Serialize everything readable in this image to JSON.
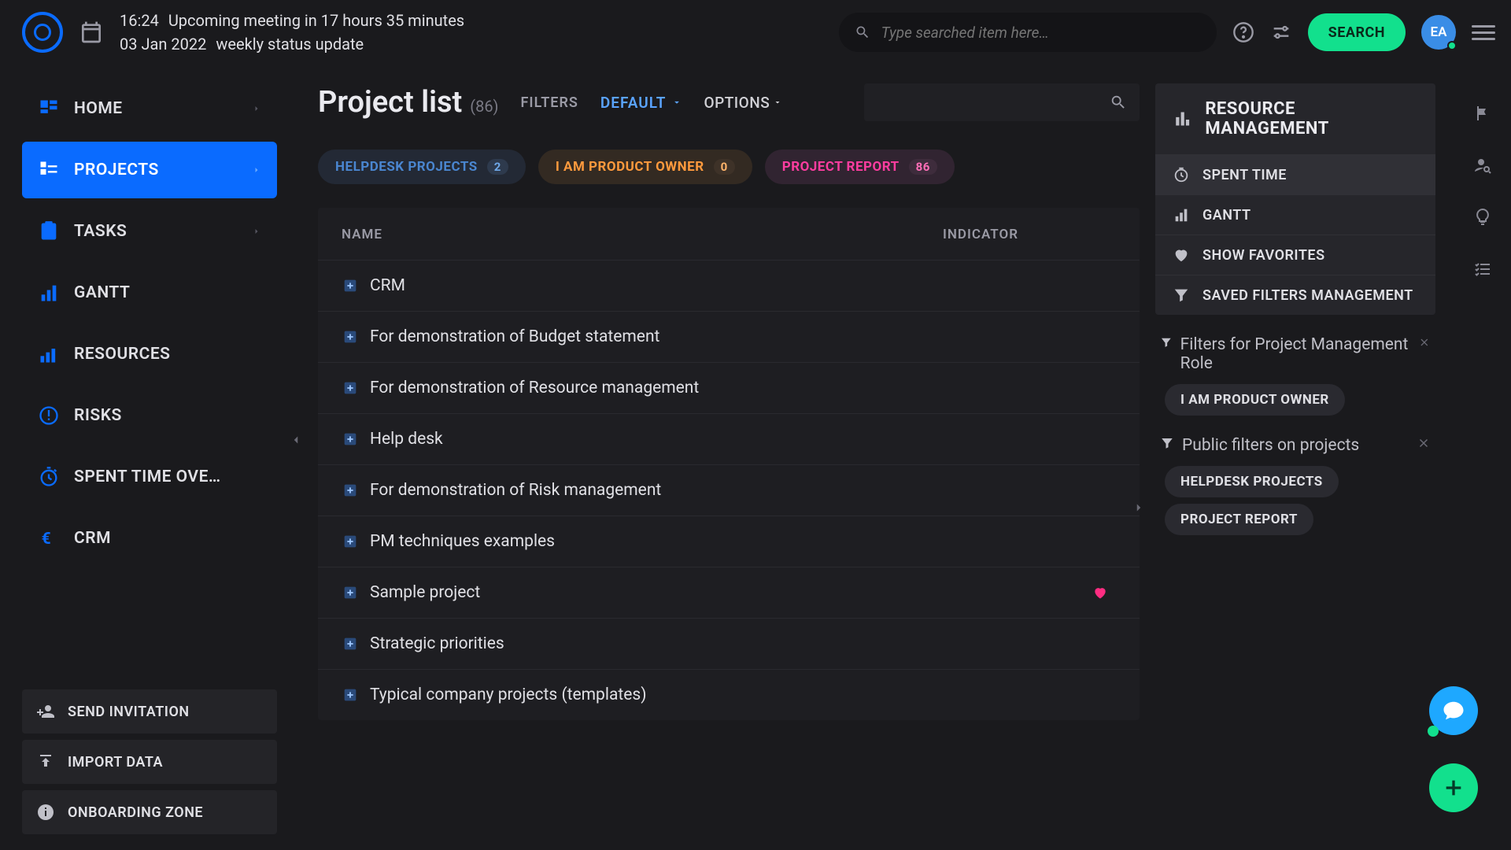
{
  "topbar": {
    "time": "16:24",
    "date": "03 Jan 2022",
    "upcoming": "Upcoming meeting in 17 hours 35 minutes",
    "event": "weekly status update",
    "search_placeholder": "Type searched item here…",
    "search_btn": "SEARCH",
    "avatar": "EA"
  },
  "sidebar": {
    "items": [
      {
        "label": "HOME",
        "icon": "home",
        "caret": true
      },
      {
        "label": "PROJECTS",
        "icon": "projects",
        "caret": true,
        "active": true
      },
      {
        "label": "TASKS",
        "icon": "tasks",
        "caret": true
      },
      {
        "label": "GANTT",
        "icon": "gantt"
      },
      {
        "label": "RESOURCES",
        "icon": "resources"
      },
      {
        "label": "RISKS",
        "icon": "risks"
      },
      {
        "label": "SPENT TIME OVE…",
        "icon": "spent"
      },
      {
        "label": "CRM",
        "icon": "crm"
      }
    ],
    "actions": {
      "invite": "SEND INVITATION",
      "import": "IMPORT DATA",
      "onboarding": "ONBOARDING ZONE"
    }
  },
  "page": {
    "title": "Project list",
    "count": "(86)",
    "filters_label": "FILTERS",
    "filters_value": "DEFAULT",
    "options_label": "OPTIONS"
  },
  "chips": [
    {
      "label": "HELPDESK PROJECTS",
      "count": "2",
      "color": "blue"
    },
    {
      "label": "I AM PRODUCT OWNER",
      "count": "0",
      "color": "orange"
    },
    {
      "label": "PROJECT REPORT",
      "count": "86",
      "color": "pink"
    }
  ],
  "table": {
    "headers": {
      "name": "NAME",
      "indicator": "INDICATOR"
    },
    "rows": [
      {
        "name": "CRM",
        "indicator": "black"
      },
      {
        "name": "For demonstration of Budget statement",
        "indicator": "orange"
      },
      {
        "name": "For demonstration of Resource management",
        "indicator": "black"
      },
      {
        "name": "Help desk",
        "indicator": "black"
      },
      {
        "name": "For demonstration of Risk management",
        "indicator": "black"
      },
      {
        "name": "PM techniques examples",
        "indicator": "black"
      },
      {
        "name": "Sample project",
        "indicator": "black",
        "favorite": true
      },
      {
        "name": "Strategic priorities",
        "indicator": "black"
      },
      {
        "name": "Typical company projects (templates)",
        "indicator": "black"
      }
    ]
  },
  "right": {
    "header": "RESOURCE MANAGEMENT",
    "items": [
      {
        "label": "SPENT TIME",
        "icon": "clock",
        "active": true
      },
      {
        "label": "GANTT",
        "icon": "bars"
      },
      {
        "label": "SHOW FAVORITES",
        "icon": "heart"
      },
      {
        "label": "SAVED FILTERS MANAGEMENT",
        "icon": "funnel"
      }
    ],
    "panel1": {
      "title": "Filters for Project Management Role",
      "pills": [
        "I AM PRODUCT OWNER"
      ]
    },
    "panel2": {
      "title": "Public filters on projects",
      "pills": [
        "HELPDESK PROJECTS",
        "PROJECT REPORT"
      ]
    }
  }
}
